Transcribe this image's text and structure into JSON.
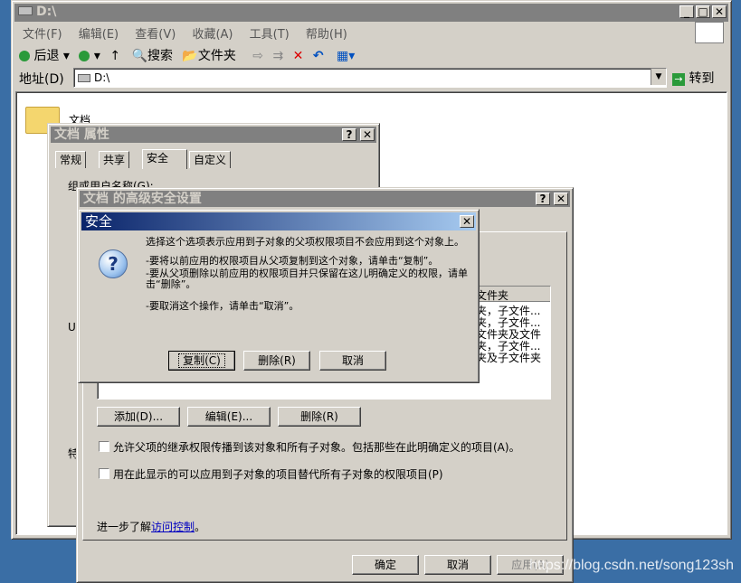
{
  "explorer": {
    "title": "D:\\",
    "menu": [
      "文件(F)",
      "编辑(E)",
      "查看(V)",
      "收藏(A)",
      "工具(T)",
      "帮助(H)"
    ],
    "toolbar": {
      "back": "后退",
      "search": "搜索",
      "folders": "文件夹"
    },
    "address_label": "地址(D)",
    "address_value": "D:\\",
    "go_label": "转到",
    "folder_label": "文档"
  },
  "props": {
    "title": "文档 属性",
    "tabs": [
      "常规",
      "共享",
      "安全",
      "自定义"
    ],
    "group_label": "组或用户名称(G):",
    "u_label": "U",
    "perm_label": "特"
  },
  "advanced": {
    "title": "文档 的高级安全设置",
    "list_items": [
      "文件夹",
      "夹，子文件...",
      "夹，子文件...",
      "文件夹及文件",
      "夹，子文件...",
      "夹及子文件夹"
    ],
    "add_label": "添加(D)...",
    "edit_label": "编辑(E)...",
    "remove_label": "删除(R)",
    "inherit_label": "允许父项的继承权限传播到该对象和所有子对象。包括那些在此明确定义的项目(A)。",
    "replace_label": "用在此显示的可以应用到子对象的项目替代所有子对象的权限项目(P)",
    "learn_prefix": "进一步了解",
    "learn_link": "访问控制",
    "learn_suffix": "。",
    "ok_label": "确定",
    "cancel_label": "取消",
    "apply_label": "应用(A)"
  },
  "security": {
    "title": "安全",
    "para1": "选择这个选项表示应用到子对象的父项权限项目不会应用到这个对象上。",
    "para2": "-要将以前应用的权限项目从父项复制到这个对象，请单击“复制”。",
    "para3": "-要从父项删除以前应用的权限项目并只保留在这儿明确定义的权限，请单击“删除”。",
    "para4": "-要取消这个操作，请单击“取消”。",
    "copy_label": "复制(C)",
    "delete_label": "删除(R)",
    "cancel_label": "取消"
  },
  "watermark": "https://blog.csdn.net/song123sh"
}
